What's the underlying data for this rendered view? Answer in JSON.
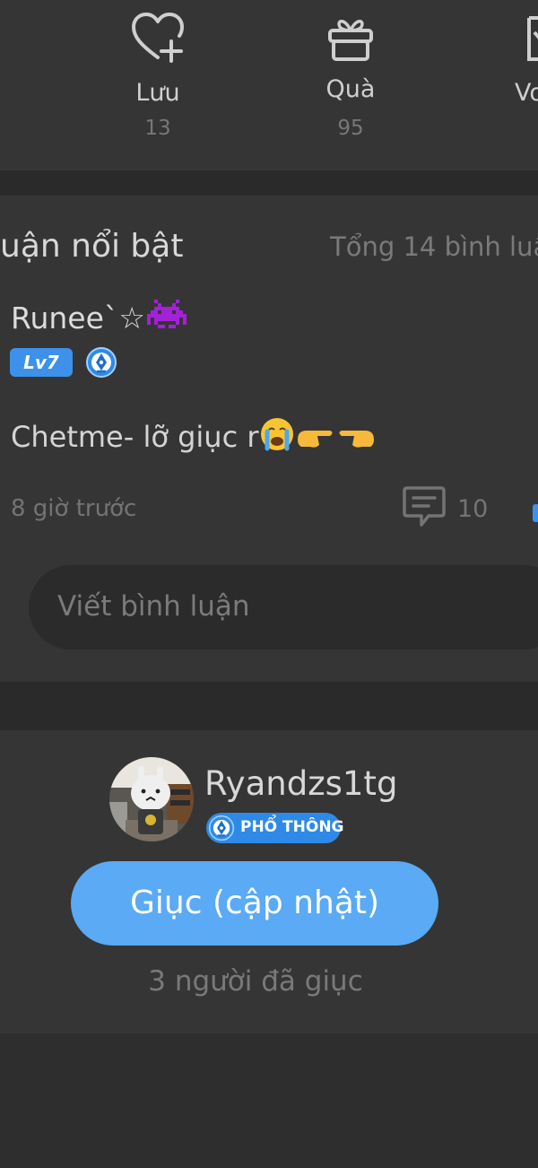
{
  "stats": {
    "save": {
      "label": "Lưu",
      "count": "13",
      "icon": "heart-plus-icon"
    },
    "gift": {
      "label": "Quà",
      "count": "95",
      "icon": "gift-icon"
    },
    "partial": {
      "label": "Vo",
      "icon": "ticket-icon"
    }
  },
  "comments": {
    "title": "uận nổi bật",
    "total": "Tổng 14 bình luậ",
    "item": {
      "author": "Runee`☆",
      "level": "Lv7",
      "text": "Chetme- lỡ giục r",
      "time": "8 giờ trước",
      "replies": "10"
    },
    "input_placeholder": "Viết bình luận"
  },
  "uploader": {
    "name": "Ryandzs1tg",
    "tier": "PHỔ THÔNG",
    "urge_button": "Giục (cập nhật)",
    "urged_count": "3 người đã giục"
  },
  "colors": {
    "background": "#2e2e2e",
    "card": "#353535",
    "accent": "#5aaaf5",
    "badge": "#3d91ea"
  }
}
